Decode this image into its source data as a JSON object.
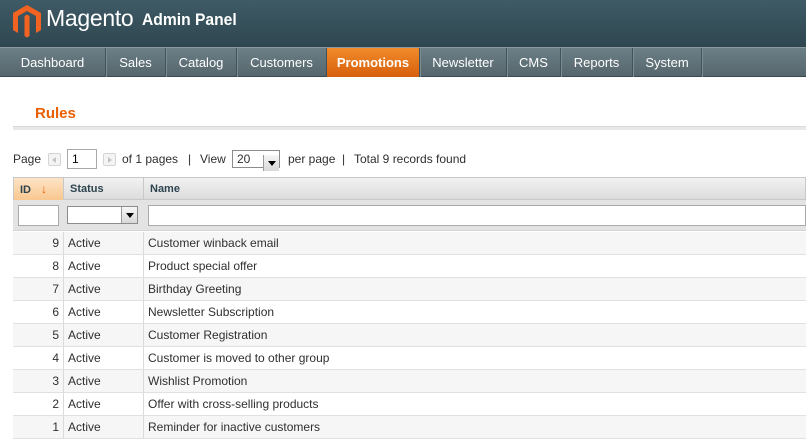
{
  "header": {
    "brand": "Magento",
    "subtitle": "Admin Panel",
    "colors": {
      "header": "#2e4650",
      "accent": "#eb5e00"
    }
  },
  "nav": {
    "items": [
      {
        "label": "Dashboard",
        "active": false
      },
      {
        "label": "Sales",
        "active": false
      },
      {
        "label": "Catalog",
        "active": false
      },
      {
        "label": "Customers",
        "active": false
      },
      {
        "label": "Promotions",
        "active": true
      },
      {
        "label": "Newsletter",
        "active": false
      },
      {
        "label": "CMS",
        "active": false
      },
      {
        "label": "Reports",
        "active": false
      },
      {
        "label": "System",
        "active": false
      }
    ]
  },
  "page": {
    "title": "Rules"
  },
  "pager": {
    "page_label": "Page",
    "page_value": "1",
    "of_pages": "of 1 pages",
    "sep1": "|",
    "view_label": "View",
    "view_value": "20",
    "per_page": "per page",
    "sep2": "|",
    "total": "Total 9 records found"
  },
  "grid": {
    "columns": [
      {
        "label": "ID",
        "sorted": true,
        "sort_icon": "↓"
      },
      {
        "label": "Status"
      },
      {
        "label": "Name"
      }
    ],
    "filters": {
      "id": "",
      "status": "",
      "name": ""
    },
    "rows": [
      {
        "id": "9",
        "status": "Active",
        "name": "Customer winback email"
      },
      {
        "id": "8",
        "status": "Active",
        "name": "Product special offer"
      },
      {
        "id": "7",
        "status": "Active",
        "name": "Birthday Greeting"
      },
      {
        "id": "6",
        "status": "Active",
        "name": "Newsletter Subscription"
      },
      {
        "id": "5",
        "status": "Active",
        "name": "Customer Registration"
      },
      {
        "id": "4",
        "status": "Active",
        "name": "Customer is moved to other group"
      },
      {
        "id": "3",
        "status": "Active",
        "name": "Wishlist Promotion"
      },
      {
        "id": "2",
        "status": "Active",
        "name": "Offer with cross-selling products"
      },
      {
        "id": "1",
        "status": "Active",
        "name": "Reminder for inactive customers"
      }
    ]
  }
}
